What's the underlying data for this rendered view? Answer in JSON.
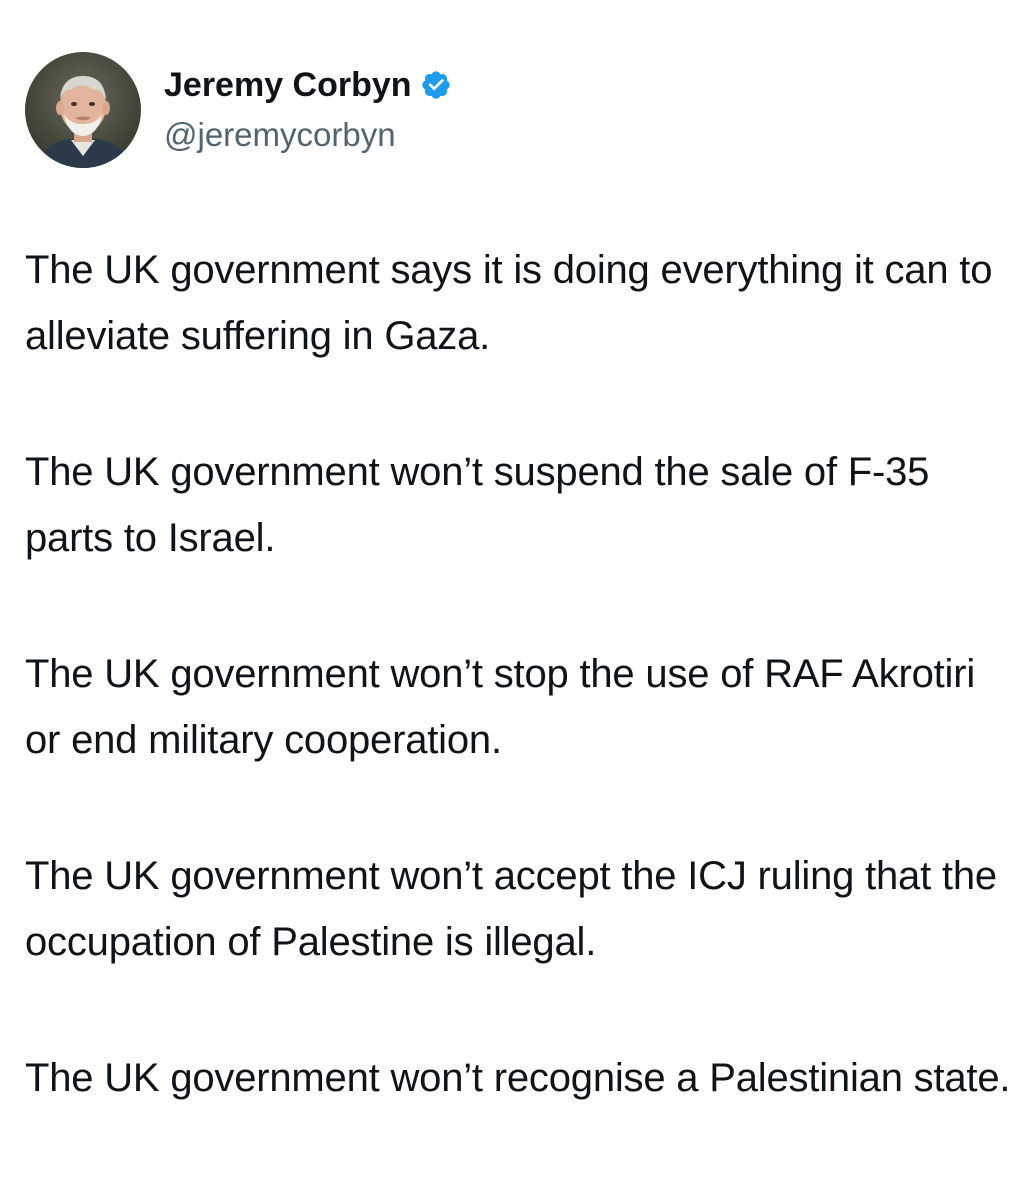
{
  "author": {
    "display_name": "Jeremy Corbyn",
    "handle": "@jeremycorbyn",
    "verified": true,
    "verified_color": "#1d9bf0",
    "avatar_icon": "profile-photo"
  },
  "tweet": {
    "paragraphs": [
      "The UK government says it is doing everything it can to alleviate suffering in Gaza.",
      "The UK government won’t suspend the sale of F-35 parts to Israel.",
      "The UK government won’t stop the use of RAF Akrotiri or end military cooperation.",
      "The UK government won’t accept the ICJ ruling that the occupation of Palestine is illegal.",
      "The UK government won’t recognise a Palestinian state."
    ]
  },
  "colors": {
    "text": "#0f1419",
    "secondary_text": "#536471",
    "background": "#ffffff"
  }
}
